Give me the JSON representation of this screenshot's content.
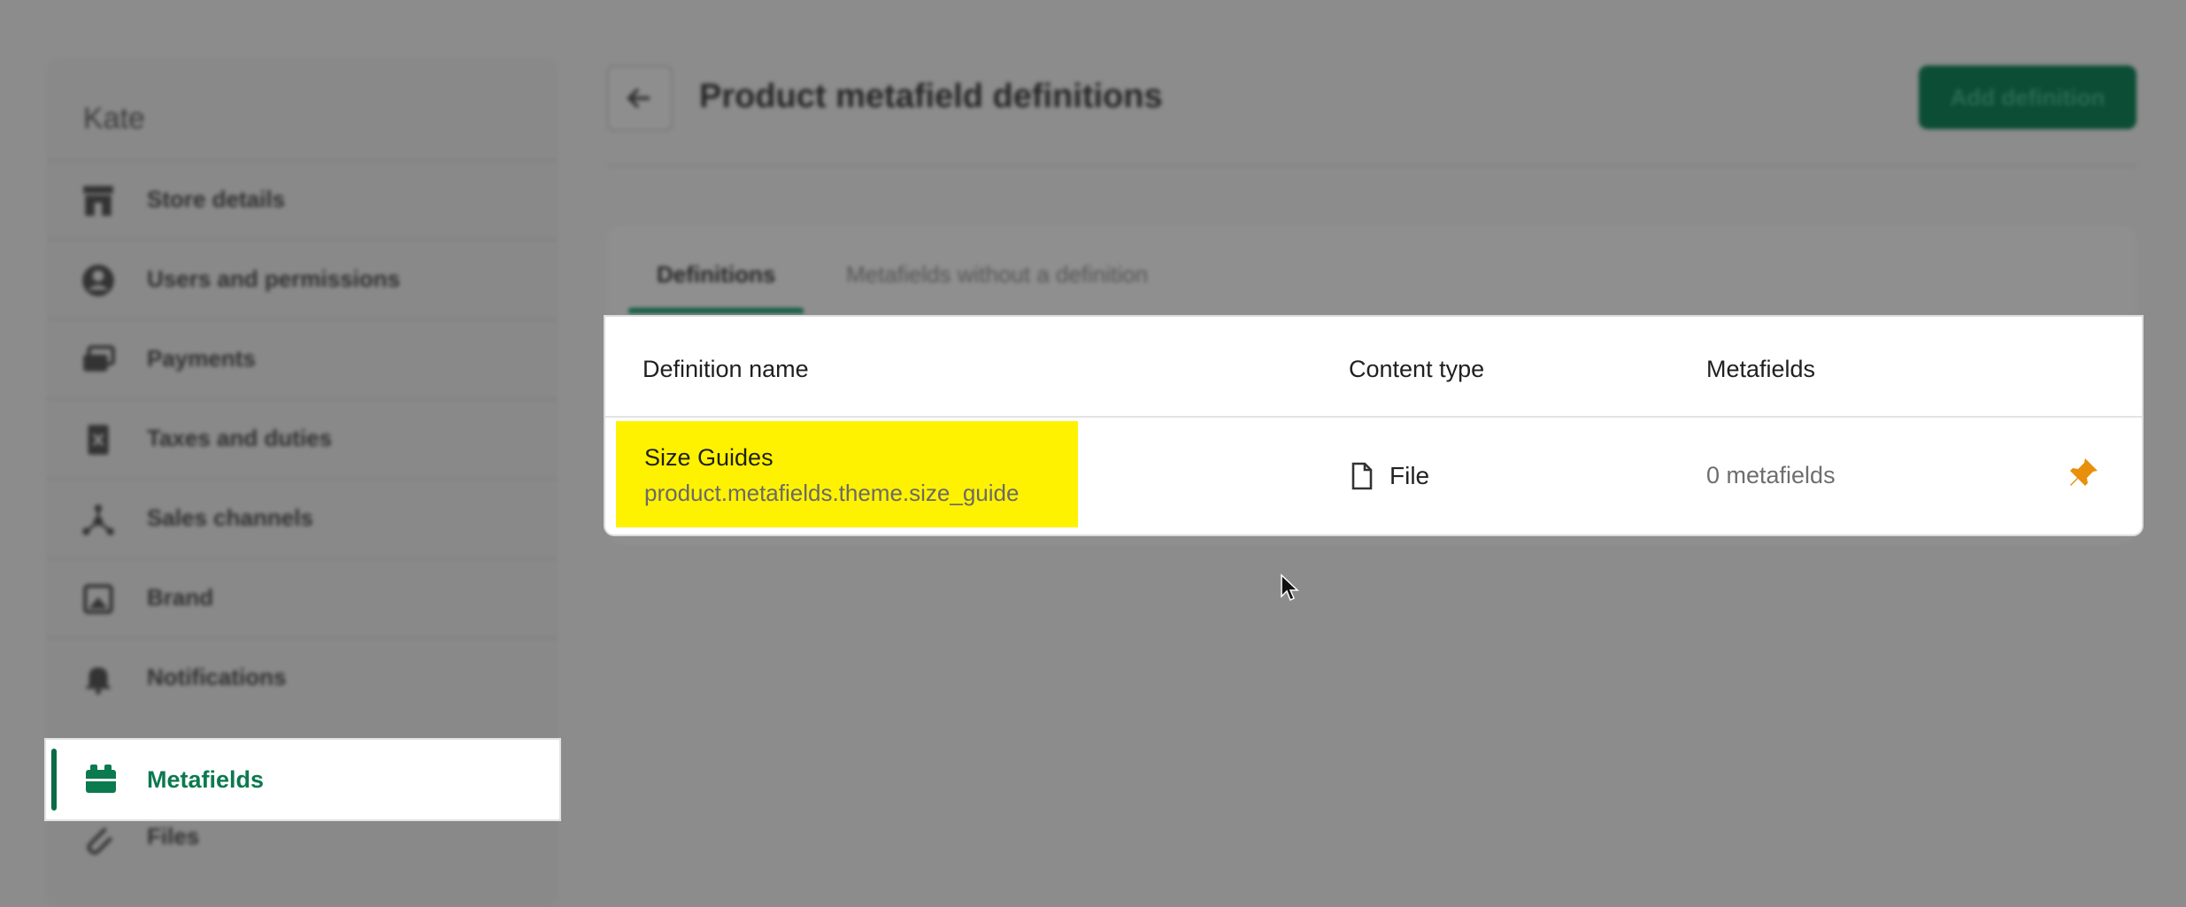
{
  "sidebar": {
    "store_name": "Kate",
    "items": [
      {
        "label": "Store details",
        "icon": "store-icon"
      },
      {
        "label": "Users and permissions",
        "icon": "user-icon"
      },
      {
        "label": "Payments",
        "icon": "payments-icon"
      },
      {
        "label": "Taxes and duties",
        "icon": "taxes-icon"
      },
      {
        "label": "Sales channels",
        "icon": "channels-icon"
      },
      {
        "label": "Brand",
        "icon": "brand-icon"
      },
      {
        "label": "Notifications",
        "icon": "bell-icon"
      },
      {
        "label": "Metafields",
        "icon": "metafields-icon",
        "active": true
      },
      {
        "label": "Files",
        "icon": "paperclip-icon"
      }
    ]
  },
  "header": {
    "title": "Product metafield definitions",
    "add_button_label": "Add definition"
  },
  "tabs": [
    {
      "label": "Definitions",
      "selected": true
    },
    {
      "label": "Metafields without a definition",
      "selected": false
    }
  ],
  "table": {
    "columns": [
      "Definition name",
      "Content type",
      "Metafields"
    ],
    "rows": [
      {
        "name": "Size Guides",
        "key": "product.metafields.theme.size_guide",
        "content_type": "File",
        "metafields": "0 metafields",
        "pinned": true
      }
    ]
  },
  "colors": {
    "accent": "#008060",
    "highlight": "#fff200",
    "pin": "#e8900c"
  }
}
